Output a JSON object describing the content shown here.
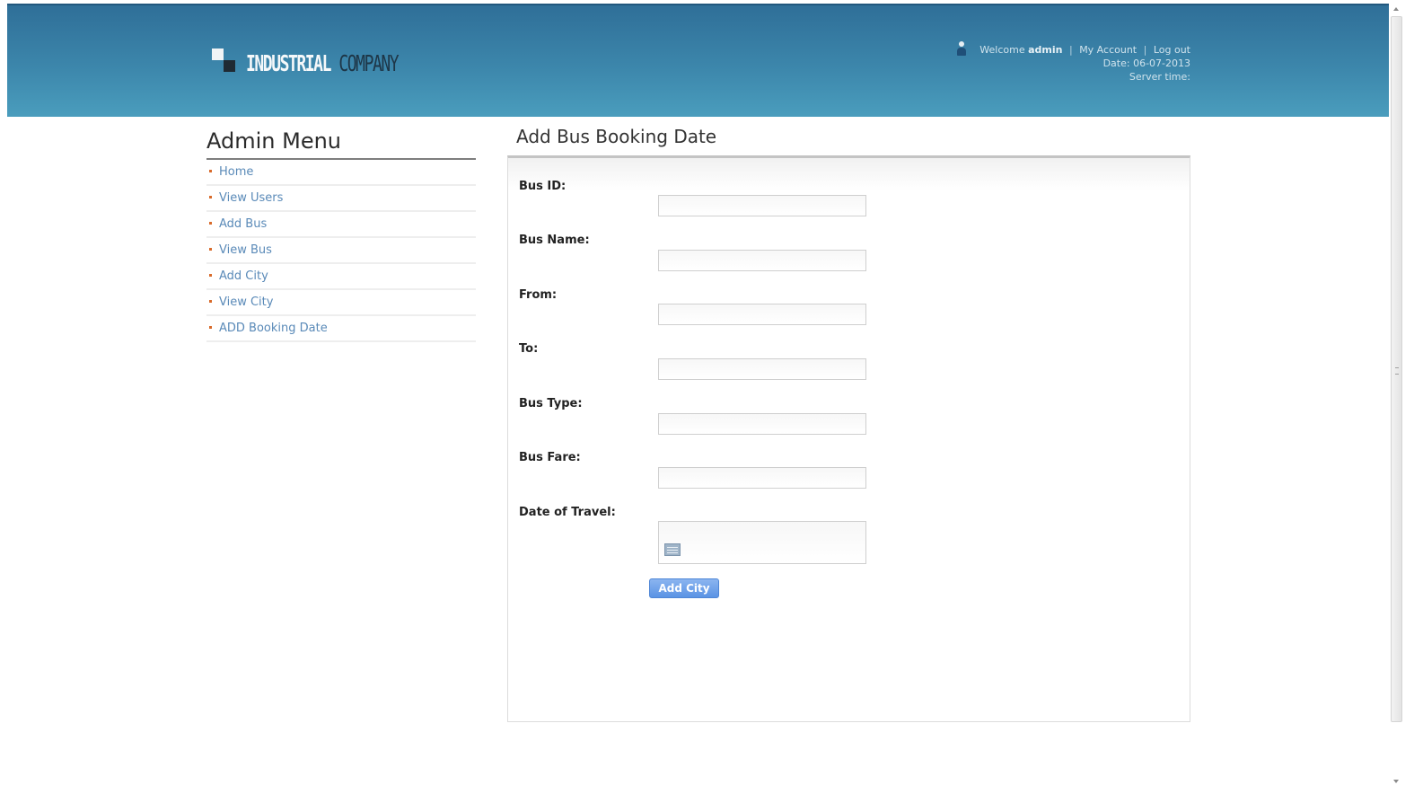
{
  "header": {
    "logo_word1": "INDUSTRIAL",
    "logo_word2": "COMPANY",
    "welcome_prefix": "Welcome",
    "username": "admin",
    "my_account": "My Account",
    "log_out": "Log out",
    "date_line": "Date: 06-07-2013",
    "server_time": "Server time:"
  },
  "sidebar": {
    "title": "Admin Menu",
    "items": [
      {
        "label": "Home"
      },
      {
        "label": "View Users"
      },
      {
        "label": "Add Bus"
      },
      {
        "label": "View Bus"
      },
      {
        "label": "Add City"
      },
      {
        "label": "View City"
      },
      {
        "label": "ADD Booking Date"
      }
    ]
  },
  "main": {
    "title": "Add Bus Booking Date",
    "form": {
      "bus_id_label": "Bus ID:",
      "bus_name_label": "Bus Name:",
      "from_label": "From:",
      "to_label": "To:",
      "bus_type_label": "Bus Type:",
      "bus_fare_label": "Bus Fare:",
      "date_of_travel_label": "Date of Travel:",
      "submit_label": "Add City"
    }
  },
  "colors": {
    "header_top": "#2f6f98",
    "header_bottom": "#4a9dbd",
    "link": "#5a8ab8",
    "bullet": "#d86a2a",
    "button": "#5a93e4"
  },
  "icons": {
    "user": "user-icon",
    "calendar": "calendar-icon"
  }
}
